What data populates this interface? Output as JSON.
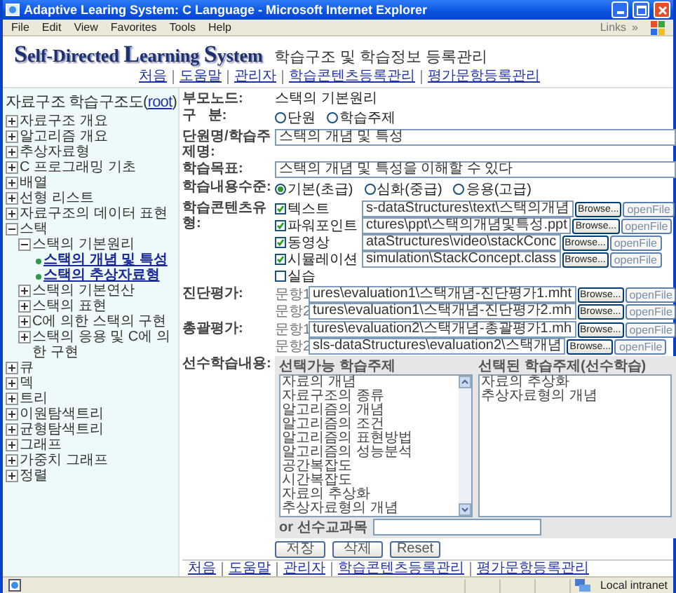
{
  "window": {
    "title": "Adaptive Learing System: C Language - Microsoft Internet Explorer"
  },
  "menu": [
    "File",
    "Edit",
    "View",
    "Favorites",
    "Tools",
    "Help"
  ],
  "links_bar": {
    "label": "Links",
    "chevron": "»"
  },
  "header": {
    "logo": "Self-Directed Learning System",
    "subtitle": "학습구조 및 학습정보 등록관리",
    "nav": [
      "처음",
      "도움말",
      "관리자",
      "학습콘텐츠등록관리",
      "평가문항등록관리"
    ]
  },
  "tree": {
    "title_before": "자료구조 학습구조도(",
    "root_link": "root",
    "title_after": ")",
    "items": [
      {
        "kind": "folder",
        "label": "자료구조 개요",
        "expanded": false
      },
      {
        "kind": "folder",
        "label": "알고리즘 개요",
        "expanded": false
      },
      {
        "kind": "folder",
        "label": "추상자료형",
        "expanded": false
      },
      {
        "kind": "folder",
        "label": "C 프로그래밍 기초",
        "expanded": false
      },
      {
        "kind": "folder",
        "label": "배열",
        "expanded": false
      },
      {
        "kind": "folder",
        "label": "선형 리스트",
        "expanded": false
      },
      {
        "kind": "folder",
        "label": "자료구조의 데이터 표현",
        "expanded": false
      },
      {
        "kind": "folder",
        "label": "스택",
        "expanded": true,
        "children": [
          {
            "kind": "folder",
            "label": "스택의 기본원리",
            "expanded": true,
            "children": [
              {
                "kind": "leaf",
                "label": "스택의 개념 및 특성"
              },
              {
                "kind": "leaf",
                "label": "스택의 추상자료형"
              }
            ]
          },
          {
            "kind": "folder",
            "label": "스택의 기본연산",
            "expanded": false
          },
          {
            "kind": "folder",
            "label": "스택의 표현",
            "expanded": false
          },
          {
            "kind": "folder",
            "label": "C에 의한 스택의 구현",
            "expanded": false
          },
          {
            "kind": "folder",
            "label": "스택의 응용 및 C에 의한 구현",
            "expanded": false
          }
        ]
      },
      {
        "kind": "folder",
        "label": "큐",
        "expanded": false
      },
      {
        "kind": "folder",
        "label": "덱",
        "expanded": false
      },
      {
        "kind": "folder",
        "label": "트리",
        "expanded": false
      },
      {
        "kind": "folder",
        "label": "이원탐색트리",
        "expanded": false
      },
      {
        "kind": "folder",
        "label": "균형탐색트리",
        "expanded": false
      },
      {
        "kind": "folder",
        "label": "그래프",
        "expanded": false
      },
      {
        "kind": "folder",
        "label": "가중치 그래프",
        "expanded": false
      },
      {
        "kind": "folder",
        "label": "정렬",
        "expanded": false
      }
    ]
  },
  "form": {
    "parent": {
      "label": "부모노드:",
      "value": "스택의 기본원리"
    },
    "category": {
      "label": "구   분:",
      "options": [
        {
          "label": "단원",
          "selected": false
        },
        {
          "label": "학습주제",
          "selected": false
        }
      ]
    },
    "unit_name": {
      "label": "단원명/학습주제명:",
      "value": "스택의 개념 및 특성"
    },
    "objective": {
      "label": "학습목표:",
      "value": "스택의 개념 및 특성을 이해할 수 있다"
    },
    "level": {
      "label": "학습내용수준:",
      "options": [
        {
          "label": "기본(초급)",
          "selected": true
        },
        {
          "label": "심화(중급)",
          "selected": false
        },
        {
          "label": "응용(고급)",
          "selected": false
        }
      ]
    },
    "content_types": {
      "label": "학습콘텐츠유형:",
      "items": [
        {
          "kind": "file",
          "label": "텍스트",
          "checked": true,
          "path": "s-dataStructures\\text\\스택의개념",
          "browse": "Browse...",
          "open": "openFile"
        },
        {
          "kind": "file",
          "label": "파워포인트",
          "checked": true,
          "path": "ctures\\ppt\\스택의개념및특성.ppt",
          "browse": "Browse...",
          "open": "openFile"
        },
        {
          "kind": "file",
          "label": "동영상",
          "checked": true,
          "path": "ataStructures\\video\\stackConc",
          "browse": "Browse...",
          "open": "openFile"
        },
        {
          "kind": "file",
          "label": "시뮬레이션",
          "checked": true,
          "path": "simulation\\StackConcept.class",
          "browse": "Browse...",
          "open": "openFile"
        },
        {
          "kind": "plain",
          "label": "실습",
          "checked": false
        }
      ]
    },
    "diagnostic": {
      "label": "진단평가:",
      "items": [
        {
          "question": "문항1",
          "path": "ures\\evaluation1\\스택개념-진단평가1.mht",
          "browse": "Browse...",
          "open": "openFile"
        },
        {
          "question": "문항2",
          "path": "tures\\evaluation1\\스택개념-진단평가2.mh",
          "browse": "Browse...",
          "open": "openFile"
        }
      ]
    },
    "summative": {
      "label": "총괄평가:",
      "items": [
        {
          "question": "문항1",
          "path": "tures\\evaluation2\\스택개념-총괄평가1.mh",
          "browse": "Browse...",
          "open": "openFile"
        },
        {
          "question": "문항2",
          "path": "sls-dataStructures\\evaluation2\\스택개념",
          "browse": "Browse...",
          "open": "openFile"
        }
      ]
    },
    "prerequisites": {
      "label": "선수학습내용:",
      "available": {
        "header": "선택가능 학습주제",
        "items": [
          "자료의 개념",
          "자료구조의 종류",
          "알고리즘의 개념",
          "알고리즘의 조건",
          "알고리즘의 표현방법",
          "알고리즘의 성능분석",
          "공간복잡도",
          "시간복잡도",
          "자료의 추상화",
          "추상자료형의 개념"
        ]
      },
      "chosen": {
        "header": "선택된 학습주제(선수학습)",
        "items": [
          "자료의 추상화",
          "추상자료형의 개념"
        ]
      },
      "or_label": "or 선수교과목"
    },
    "buttons": [
      "저장",
      "삭제",
      "Reset"
    ]
  },
  "footer_nav": [
    "처음",
    "도움말",
    "관리자",
    "학습콘텐츠등록관리",
    "평가문항등록관리"
  ],
  "status_bar": {
    "zone": "Local intranet"
  }
}
